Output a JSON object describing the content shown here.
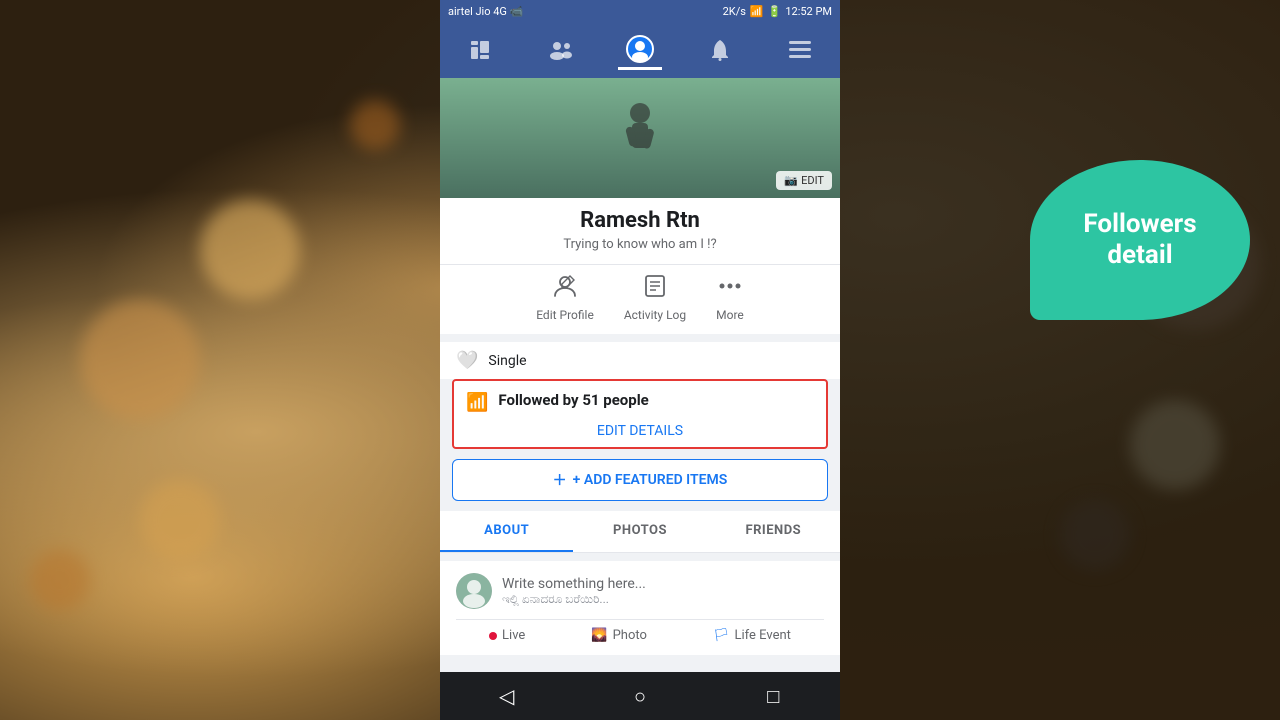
{
  "statusBar": {
    "carrier": "airtel Jio 4G",
    "speed": "2K/s",
    "time": "12:52 PM"
  },
  "nav": {
    "icons": [
      "feed-icon",
      "friends-icon",
      "profile-icon",
      "notifications-icon",
      "menu-icon"
    ]
  },
  "profile": {
    "name": "Ramesh Rtn",
    "bio": "Trying to know who am I !?",
    "coverEditLabel": "EDIT",
    "editProfileLabel": "Edit Profile",
    "activityLogLabel": "Activity Log",
    "moreLabel": "More"
  },
  "infoSection": {
    "singleLabel": "Single",
    "followedText": "Followed by ",
    "followedCount": "51 people",
    "editDetailsLabel": "EDIT DETAILS"
  },
  "featuredButton": {
    "label": "+ ADD FEATURED ITEMS"
  },
  "tabs": {
    "about": "ABOUT",
    "photos": "PHOTOS",
    "friends": "FRIENDS"
  },
  "postArea": {
    "writePlaceholder": "Write something here...",
    "writeSubPlaceholder": "ಇಲ್ಲಿ ಏನಾದರೂ ಬರೆಯಿರಿ...",
    "liveLabel": "Live",
    "photoLabel": "Photo",
    "lifeEventLabel": "Life Event"
  },
  "tooltip": {
    "line1": "Followers",
    "line2": "detail"
  }
}
